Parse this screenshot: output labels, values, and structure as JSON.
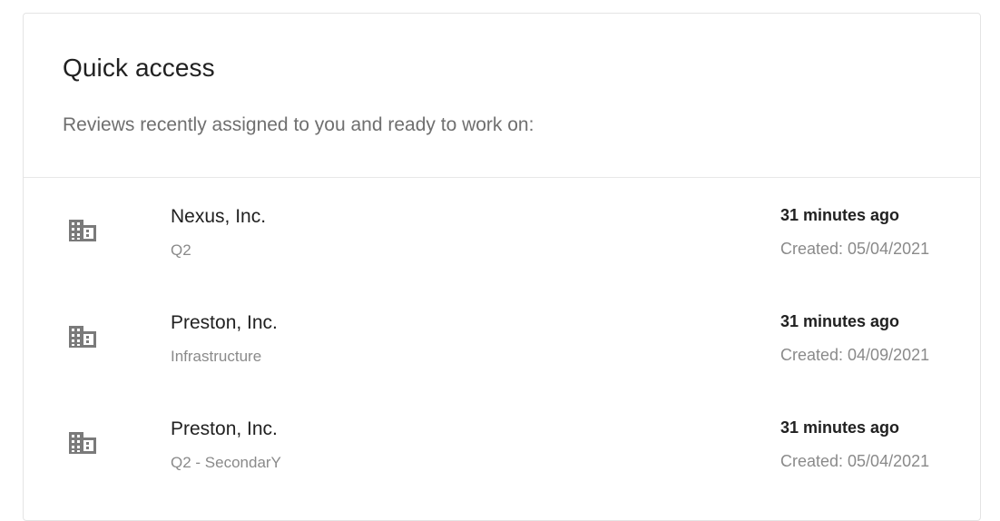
{
  "quick_access": {
    "title": "Quick access",
    "subtitle": "Reviews recently assigned to you and ready to work on:",
    "items": [
      {
        "icon": "building-icon",
        "name": "Nexus, Inc.",
        "sub": "Q2",
        "time": "31 minutes ago",
        "created": "Created: 05/04/2021"
      },
      {
        "icon": "building-icon",
        "name": "Preston, Inc.",
        "sub": "Infrastructure",
        "time": "31 minutes ago",
        "created": "Created: 04/09/2021"
      },
      {
        "icon": "building-icon",
        "name": "Preston, Inc.",
        "sub": "Q2 - SecondarY",
        "time": "31 minutes ago",
        "created": "Created: 05/04/2021"
      }
    ]
  },
  "colors": {
    "title": "#212121",
    "subtitle": "#6f6f6f",
    "muted": "#8a8a8a",
    "icon": "#7a7a7a",
    "border": "#e4e4e4"
  }
}
